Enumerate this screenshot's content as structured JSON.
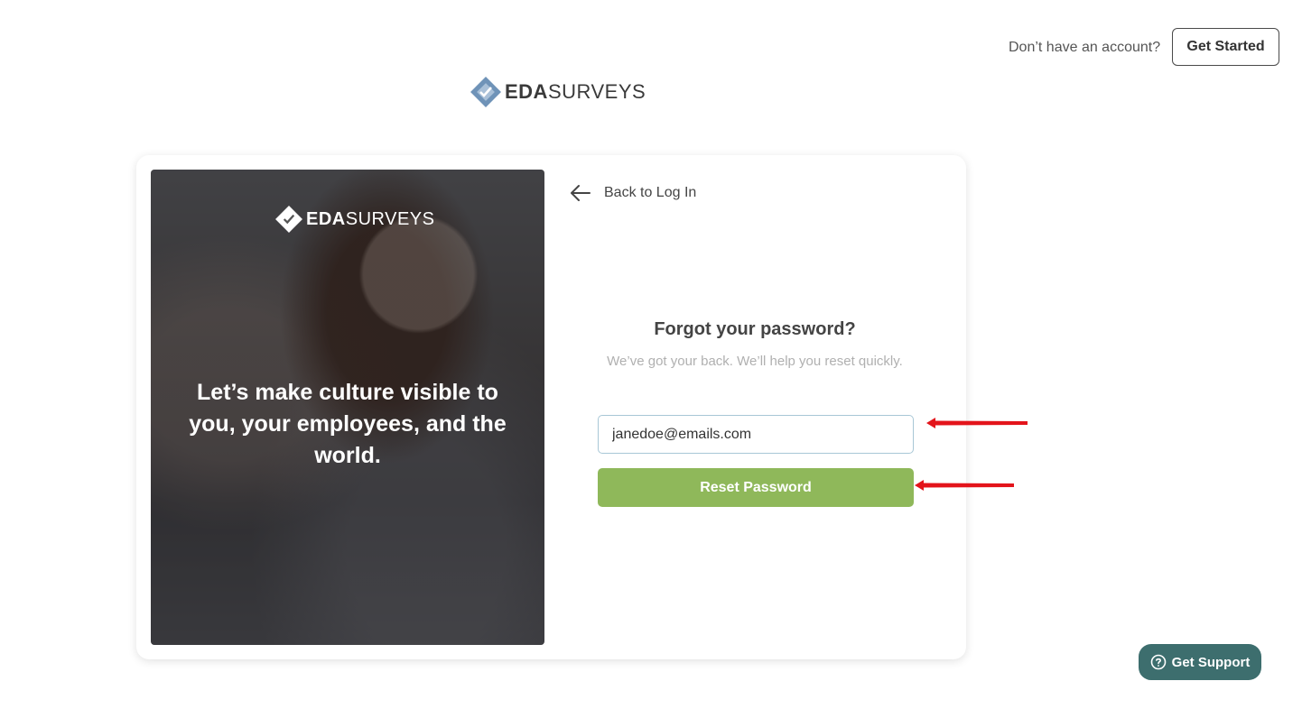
{
  "header": {
    "account_prompt": "Don’t have an account?",
    "get_started_label": "Get Started",
    "logo": {
      "bold": "EDA",
      "regular": "SURVEYS"
    }
  },
  "hero": {
    "logo": {
      "bold": "EDA",
      "regular": "SURVEYS"
    },
    "tagline": "Let’s make culture visible to you, your employees, and the world."
  },
  "form": {
    "back_label": "Back to Log In",
    "title": "Forgot your password?",
    "subtitle": "We’ve got your back. We’ll help you reset quickly.",
    "email_value": "janedoe@emails.com",
    "reset_label": "Reset Password"
  },
  "support": {
    "label": "Get Support"
  },
  "colors": {
    "accent_green": "#8fb85a",
    "support_teal": "#3d6e6e",
    "logo_blue": "#6f93b8",
    "annotation_red": "#e3141b"
  },
  "icons": [
    "logo-diamond-icon",
    "back-arrow-icon",
    "help-circle-icon",
    "annotation-arrow-icon"
  ]
}
